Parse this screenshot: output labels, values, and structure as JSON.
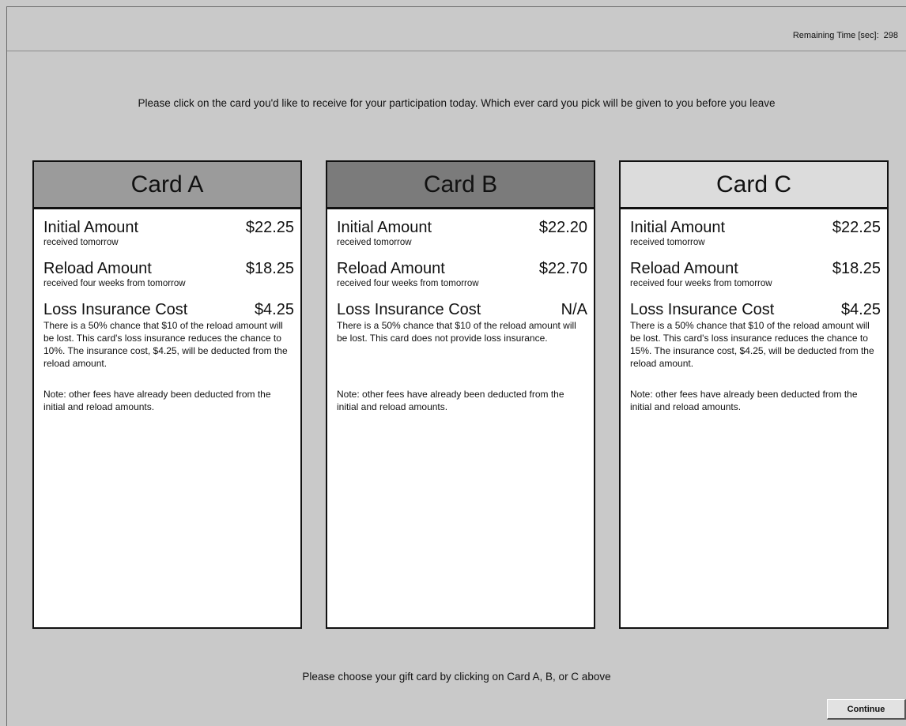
{
  "header": {
    "timer_label": "Remaining Time [sec]:",
    "timer_value": "298"
  },
  "instruction": "Please click on the card you'd like to receive for your participation today. Which ever card you pick will be given to you before you leave",
  "cards": [
    {
      "title": "Card A",
      "initial_label": "Initial Amount",
      "initial_value": "$22.25",
      "initial_sub": "received tomorrow",
      "reload_label": "Reload Amount",
      "reload_value": "$18.25",
      "reload_sub": "received four weeks from tomorrow",
      "insurance_label": "Loss Insurance Cost",
      "insurance_value": "$4.25",
      "insurance_desc": "There is a 50% chance that $10 of the reload amount will be lost. This card's loss insurance reduces the chance to 10%.  The insurance cost, $4.25, will be deducted from the reload amount.",
      "note": "Note: other fees have already been deducted from the initial and reload amounts."
    },
    {
      "title": "Card B",
      "initial_label": "Initial Amount",
      "initial_value": "$22.20",
      "initial_sub": "received tomorrow",
      "reload_label": "Reload Amount",
      "reload_value": "$22.70",
      "reload_sub": "received four weeks from tomorrow",
      "insurance_label": "Loss Insurance Cost",
      "insurance_value": "N/A",
      "insurance_desc": "There is a 50% chance that $10 of the reload amount will be lost. This card does not provide loss insurance.",
      "note": "Note: other fees have already been deducted from the initial and reload amounts."
    },
    {
      "title": "Card C",
      "initial_label": "Initial Amount",
      "initial_value": "$22.25",
      "initial_sub": "received tomorrow",
      "reload_label": "Reload Amount",
      "reload_value": "$18.25",
      "reload_sub": "received four weeks from tomorrow",
      "insurance_label": "Loss Insurance Cost",
      "insurance_value": "$4.25",
      "insurance_desc": "There is a 50% chance that $10 of the reload amount will be lost. This card's loss insurance reduces the chance to 15%. The insurance cost, $4.25, will be deducted from the reload amount.",
      "note": "Note: other fees have already been deducted from the initial and reload amounts."
    }
  ],
  "footer": {
    "prompt": "Please choose your gift card by clicking on Card A, B, or C above",
    "continue_label": "Continue"
  },
  "colors": {
    "background": "#c9c9c9",
    "card_a_header": "#9b9b9b",
    "card_b_header": "#7b7b7b",
    "card_c_header": "#dcdcdc"
  }
}
